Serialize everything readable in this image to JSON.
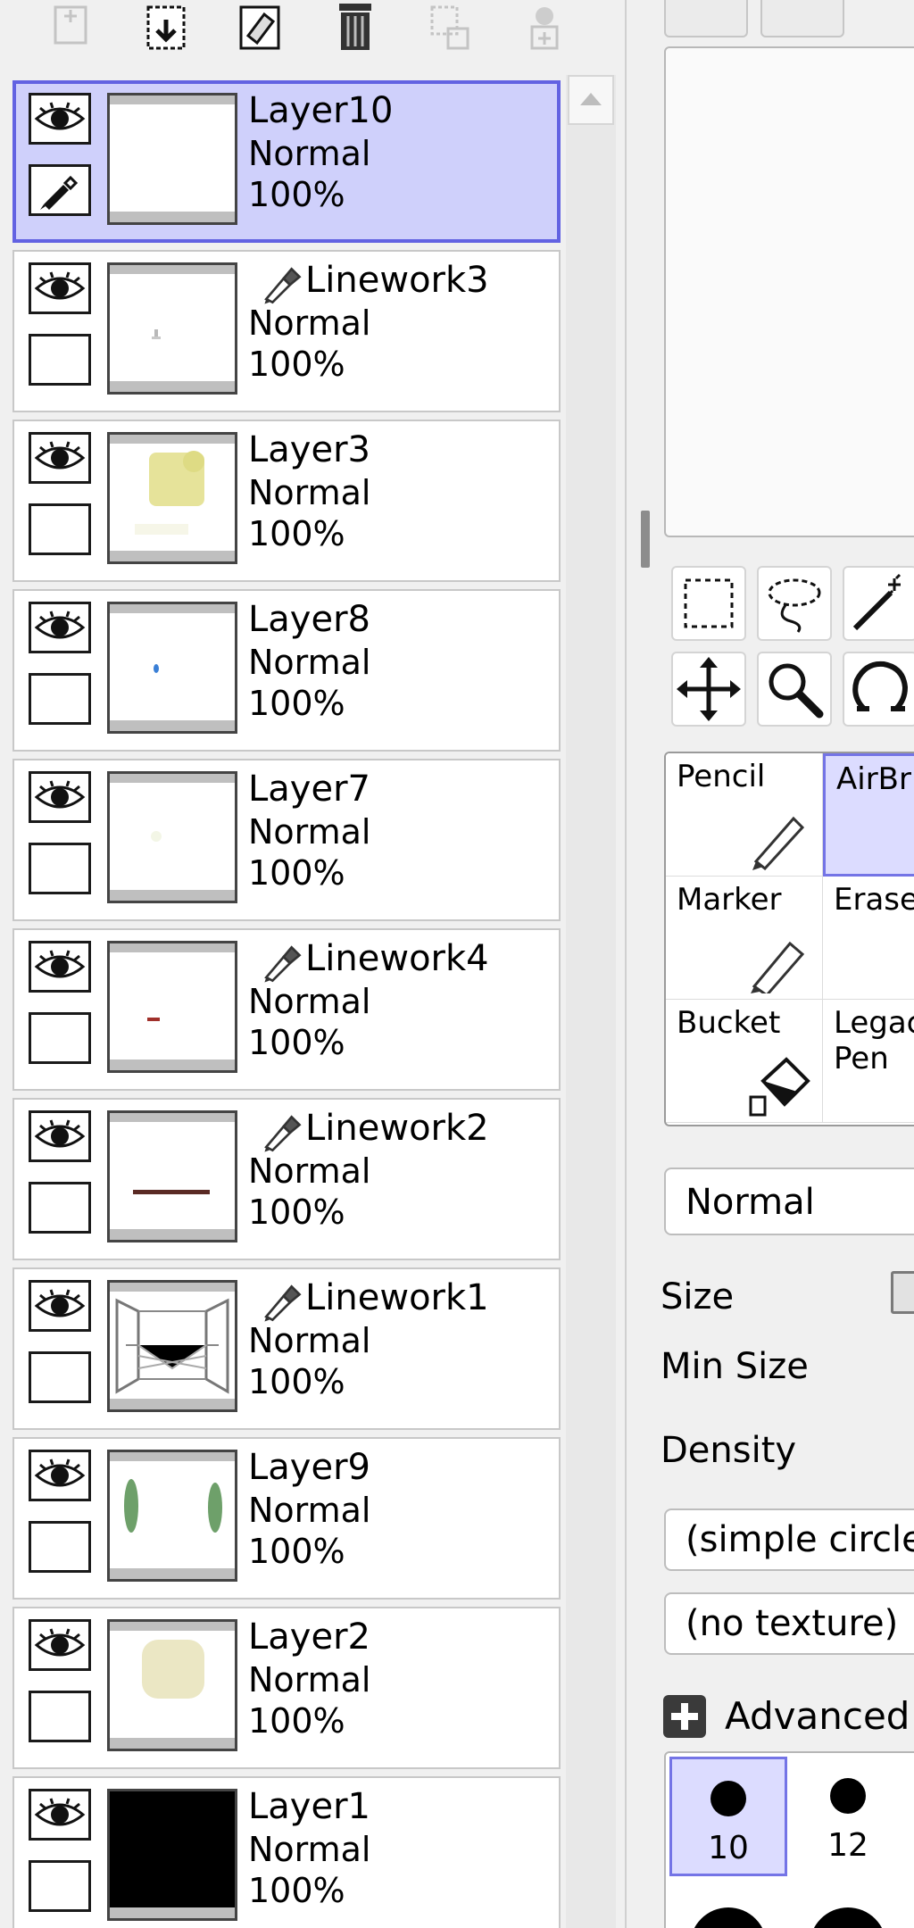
{
  "layer_panel": {
    "toolbar": [
      {
        "icon": "new-layer-icon",
        "enabled": false
      },
      {
        "icon": "paste-layer-icon",
        "enabled": true
      },
      {
        "icon": "clear-layer-icon",
        "enabled": true
      },
      {
        "icon": "delete-layer-icon",
        "enabled": true
      },
      {
        "icon": "transfer-down-icon",
        "enabled": false
      },
      {
        "icon": "merge-down-icon",
        "enabled": false
      }
    ],
    "layers": [
      {
        "name": "Layer10",
        "mode": "Normal",
        "opacity": "100%",
        "selected": true,
        "linework": false,
        "thumb": "blank"
      },
      {
        "name": "Linework3",
        "mode": "Normal",
        "opacity": "100%",
        "selected": false,
        "linework": true,
        "thumb": "tiny-mark"
      },
      {
        "name": "Layer3",
        "mode": "Normal",
        "opacity": "100%",
        "selected": false,
        "linework": false,
        "thumb": "yellow-blob"
      },
      {
        "name": "Layer8",
        "mode": "Normal",
        "opacity": "100%",
        "selected": false,
        "linework": false,
        "thumb": "blue-dot"
      },
      {
        "name": "Layer7",
        "mode": "Normal",
        "opacity": "100%",
        "selected": false,
        "linework": false,
        "thumb": "faint"
      },
      {
        "name": "Linework4",
        "mode": "Normal",
        "opacity": "100%",
        "selected": false,
        "linework": true,
        "thumb": "red-dash"
      },
      {
        "name": "Linework2",
        "mode": "Normal",
        "opacity": "100%",
        "selected": false,
        "linework": true,
        "thumb": "brown-line"
      },
      {
        "name": "Linework1",
        "mode": "Normal",
        "opacity": "100%",
        "selected": false,
        "linework": true,
        "thumb": "room-sketch"
      },
      {
        "name": "Layer9",
        "mode": "Normal",
        "opacity": "100%",
        "selected": false,
        "linework": false,
        "thumb": "green-strokes"
      },
      {
        "name": "Layer2",
        "mode": "Normal",
        "opacity": "100%",
        "selected": false,
        "linework": false,
        "thumb": "beige-blob"
      },
      {
        "name": "Layer1",
        "mode": "Normal",
        "opacity": "100%",
        "selected": false,
        "linework": false,
        "thumb": "black"
      }
    ]
  },
  "tools": {
    "selection": [
      "rect-select-icon",
      "lasso-icon",
      "magic-wand-icon"
    ],
    "navigation": [
      "move-icon",
      "zoom-icon",
      "rotate-icon"
    ]
  },
  "brushes": [
    {
      "label": "Pencil",
      "icon": "pencil-icon",
      "selected": false
    },
    {
      "label": "AirBr",
      "icon": "airbrush-icon",
      "selected": true
    },
    {
      "label": "Marker",
      "icon": "marker-icon",
      "selected": false
    },
    {
      "label": "Erase",
      "icon": "eraser-icon",
      "selected": false
    },
    {
      "label": "Bucket",
      "icon": "bucket-icon",
      "selected": false
    },
    {
      "label": "Legac\nPen",
      "icon": "pen-icon",
      "selected": false
    }
  ],
  "brush_settings": {
    "blend_mode": "Normal",
    "size_label": "Size",
    "min_size_label": "Min Size",
    "density_label": "Density",
    "shape": "(simple circle",
    "texture": "(no texture)",
    "advanced_label": "Advanced"
  },
  "size_presets": [
    {
      "label": "10",
      "selected": true
    },
    {
      "label": "12",
      "selected": false
    },
    {
      "label": "",
      "selected": false
    },
    {
      "label": "",
      "selected": false
    }
  ],
  "colors": {
    "selection_fill": "#cfd0fb",
    "selection_border": "#6262e2",
    "panel_bg": "#f0f0f0"
  }
}
